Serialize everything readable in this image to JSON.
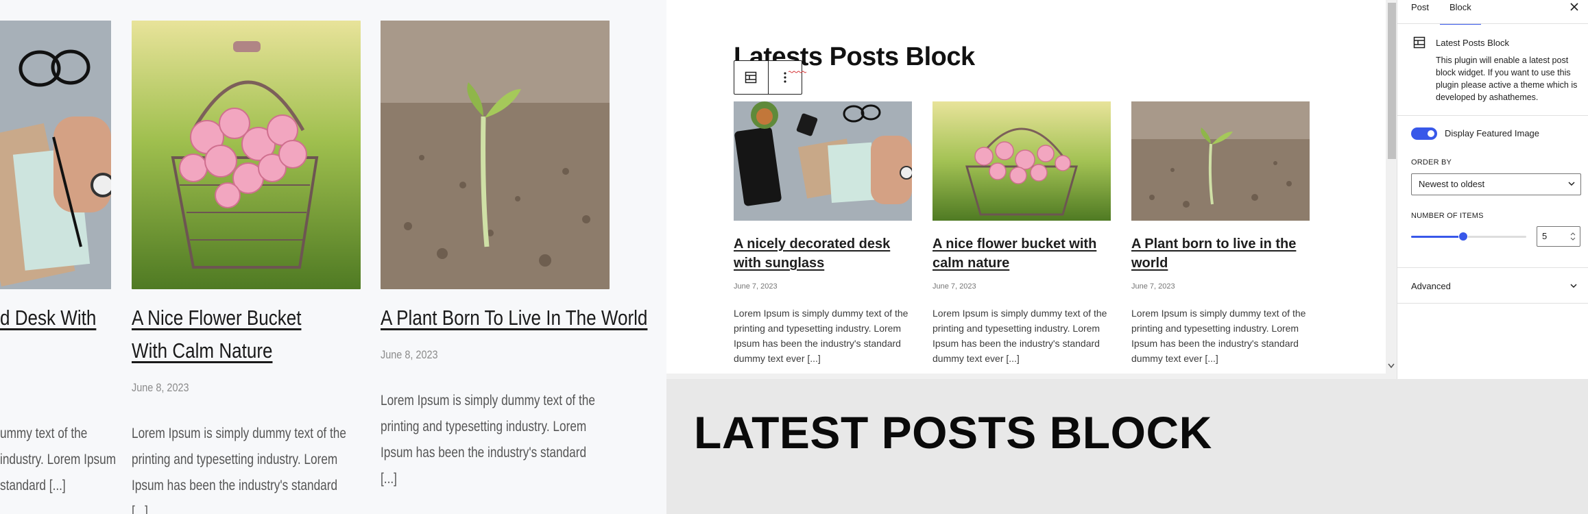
{
  "frontend": {
    "posts": [
      {
        "title": "A Nicely Decorated Desk With Sunglass",
        "title_visible": "d Desk With",
        "date": "",
        "excerpt_lines": [
          "ummy text of the",
          "industry. Lorem Ipsum",
          "standard [...]"
        ]
      },
      {
        "title": "A Nice Flower Bucket With Calm Nature",
        "date": "June 8, 2023",
        "excerpt": "Lorem Ipsum is simply dummy text of the printing and typesetting industry. Lorem Ipsum has been the industry's standard [...]"
      },
      {
        "title": "A Plant Born To Live In The World",
        "date": "June 8, 2023",
        "excerpt": "Lorem Ipsum is simply dummy text of the printing and typesetting industry. Lorem Ipsum has been the industry's standard [...]"
      }
    ]
  },
  "editor": {
    "heading": "Latests Posts Block",
    "toolbar": {
      "block_icon": "latest-posts-block-icon",
      "options_icon": "more-options-icon"
    },
    "posts": [
      {
        "title": "A nicely decorated desk with sunglass",
        "date": "June 7, 2023",
        "excerpt": "Lorem Ipsum is simply dummy text of the printing and typesetting industry. Lorem Ipsum has been the industry's standard dummy text ever [...]"
      },
      {
        "title": "A nice flower bucket with calm nature",
        "date": "June 7, 2023",
        "excerpt": "Lorem Ipsum is simply dummy text of the printing and typesetting industry. Lorem Ipsum has been the industry's standard dummy text ever [...]"
      },
      {
        "title": "A Plant born to live in the world",
        "date": "June 7, 2023",
        "excerpt": "Lorem Ipsum is simply dummy text of the printing and typesetting industry. Lorem Ipsum has been the industry's standard dummy text ever [...]"
      }
    ]
  },
  "sidebar": {
    "tabs": {
      "post": "Post",
      "block": "Block"
    },
    "close_icon": "close-icon",
    "block_card": {
      "title": "Latest Posts Block",
      "description": "This plugin will enable a latest post block widget. If you want to use this plugin please active a theme which is developed by ashathemes."
    },
    "featured_image_toggle": {
      "label": "Display Featured Image",
      "checked": true
    },
    "order_by": {
      "label": "ORDER BY",
      "selected": "Newest to oldest"
    },
    "number_of_items": {
      "label": "NUMBER OF ITEMS",
      "value": "5",
      "min": 1,
      "max": 10,
      "slider_fraction": 0.45
    },
    "advanced": {
      "label": "Advanced"
    }
  },
  "banner": {
    "title": "LATEST POSTS BLOCK"
  },
  "colors": {
    "accent": "#3858e9",
    "toggle": "#3858e9",
    "text": "#1e1e1e",
    "banner_bg": "#e8e8e8"
  }
}
